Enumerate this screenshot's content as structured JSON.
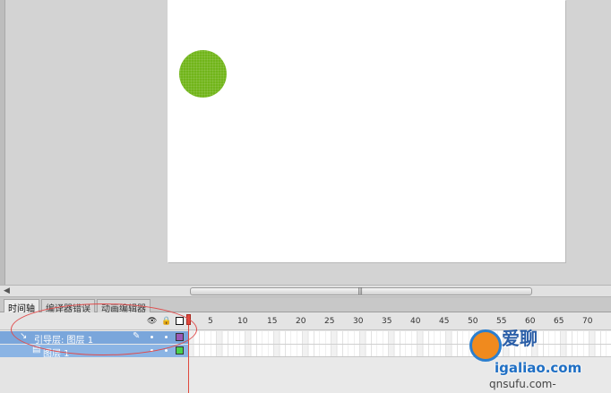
{
  "panel_tabs": [
    {
      "label": "时间轴",
      "active": true
    },
    {
      "label": "编译器错误",
      "active": false
    },
    {
      "label": "动画编辑器",
      "active": false
    }
  ],
  "timeline": {
    "frame_ticks": [
      "5",
      "10",
      "15",
      "20",
      "25",
      "30",
      "35",
      "40",
      "45",
      "50",
      "55",
      "60",
      "65",
      "70"
    ],
    "layers": [
      {
        "name": "引导层: 图层 1",
        "color": "#9b59b6"
      },
      {
        "name": "图层 1",
        "color": "#4cd14c"
      }
    ]
  },
  "scrollbar": {
    "grip": "|||"
  },
  "icons": {
    "eye": "eye-icon",
    "lock": "lock-icon",
    "outline": "outline-icon",
    "pencil": "pencil-icon",
    "guide": "guide-layer-icon",
    "layer": "layer-icon"
  },
  "watermark": {
    "title": "爱聊",
    "url": "igaliao.com",
    "sub": "qnsufu.com-"
  },
  "colors": {
    "ball": "#71b51a",
    "playhead": "#e0483c",
    "selection": "#7aa6db"
  }
}
